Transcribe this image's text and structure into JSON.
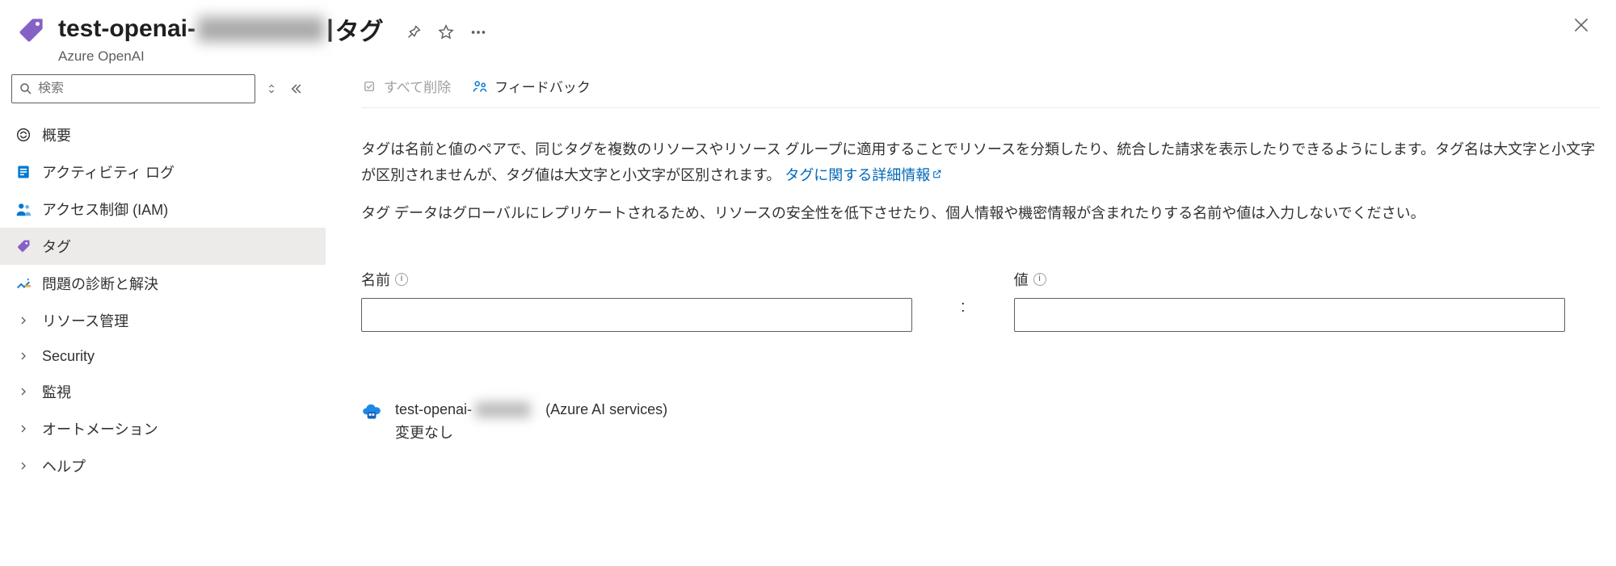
{
  "header": {
    "title_prefix": "test-openai-",
    "title_redacted": "xxxxxxxxx",
    "title_divider": " | ",
    "title_section": "タグ",
    "subtitle": "Azure OpenAI"
  },
  "sidebar": {
    "search_placeholder": "検索",
    "items": [
      {
        "icon": "openai-icon",
        "label": "概要"
      },
      {
        "icon": "log-icon",
        "label": "アクティビティ ログ"
      },
      {
        "icon": "people-icon",
        "label": "アクセス制御 (IAM)"
      },
      {
        "icon": "tag-icon",
        "label": "タグ",
        "active": true
      },
      {
        "icon": "diagnose-icon",
        "label": "問題の診断と解決"
      },
      {
        "icon": "chevron-icon",
        "label": "リソース管理",
        "expandable": true
      },
      {
        "icon": "chevron-icon",
        "label": "Security",
        "expandable": true
      },
      {
        "icon": "chevron-icon",
        "label": "監視",
        "expandable": true
      },
      {
        "icon": "chevron-icon",
        "label": "オートメーション",
        "expandable": true
      },
      {
        "icon": "chevron-icon",
        "label": "ヘルプ",
        "expandable": true
      }
    ]
  },
  "toolbar": {
    "delete_all": "すべて削除",
    "feedback": "フィードバック"
  },
  "content": {
    "desc1_a": "タグは名前と値のペアで、同じタグを複数のリソースやリソース グループに適用することでリソースを分類したり、統合した請求を表示したりできるようにします。タグ名は大文字と小文字が区別されませんが、タグ値は大文字と小文字が区別されます。",
    "desc1_link": "タグに関する詳細情報",
    "desc2": "タグ データはグローバルにレプリケートされるため、リソースの安全性を低下させたり、個人情報や機密情報が含まれたりする名前や値は入力しないでください。",
    "label_name": "名前",
    "label_value": "値",
    "colon": ":",
    "name_value": "",
    "value_value": ""
  },
  "resource": {
    "name_prefix": "test-openai-",
    "name_redacted": "xxxxxxx",
    "service": "(Azure AI services)",
    "status": "変更なし"
  }
}
